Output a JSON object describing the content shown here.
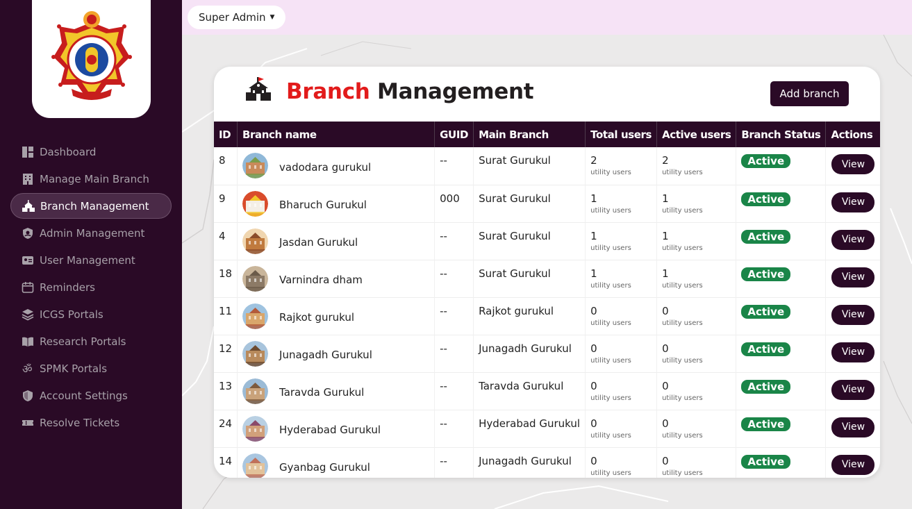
{
  "sidebar": {
    "items": [
      {
        "label": "Dashboard",
        "icon": "dashboard-icon"
      },
      {
        "label": "Manage Main Branch",
        "icon": "building-icon"
      },
      {
        "label": "Branch Management",
        "icon": "school-icon",
        "active": true
      },
      {
        "label": "Admin Management",
        "icon": "admin-shield-icon"
      },
      {
        "label": "User Management",
        "icon": "id-card-icon"
      },
      {
        "label": "Reminders",
        "icon": "calendar-icon"
      },
      {
        "label": "ICGS Portals",
        "icon": "layers-icon"
      },
      {
        "label": "Research Portals",
        "icon": "book-open-icon"
      },
      {
        "label": "SPMK Portals",
        "icon": "om-icon"
      },
      {
        "label": "Account Settings",
        "icon": "shield-icon"
      },
      {
        "label": "Resolve Tickets",
        "icon": "ticket-icon"
      }
    ]
  },
  "topbar": {
    "user_menu": "Super Admin"
  },
  "header": {
    "title_accent": "Branch",
    "title_rest": " Management",
    "add_button": "Add branch"
  },
  "table": {
    "columns": [
      "ID",
      "Branch name",
      "GUID",
      "Main Branch",
      "Total users",
      "Active users",
      "Branch Status",
      "Actions"
    ],
    "users_caption": "utility users",
    "rows": [
      {
        "id": "8",
        "name": "vadodara gurukul",
        "guid": "--",
        "main_branch": "Surat Gurukul",
        "total_users": "2",
        "active_users": "2",
        "status": "Active",
        "action": "View"
      },
      {
        "id": "9",
        "name": "Bharuch Gurukul",
        "guid": "000",
        "main_branch": "Surat Gurukul",
        "total_users": "1",
        "active_users": "1",
        "status": "Active",
        "action": "View"
      },
      {
        "id": "4",
        "name": "Jasdan Gurukul",
        "guid": "--",
        "main_branch": "Surat Gurukul",
        "total_users": "1",
        "active_users": "1",
        "status": "Active",
        "action": "View"
      },
      {
        "id": "18",
        "name": "Varnindra dham",
        "guid": "--",
        "main_branch": "Surat Gurukul",
        "total_users": "1",
        "active_users": "1",
        "status": "Active",
        "action": "View"
      },
      {
        "id": "11",
        "name": "Rajkot gurukul",
        "guid": "--",
        "main_branch": "Rajkot gurukul",
        "total_users": "0",
        "active_users": "0",
        "status": "Active",
        "action": "View"
      },
      {
        "id": "12",
        "name": "Junagadh Gurukul",
        "guid": "--",
        "main_branch": "Junagadh Gurukul",
        "total_users": "0",
        "active_users": "0",
        "status": "Active",
        "action": "View"
      },
      {
        "id": "13",
        "name": "Taravda Gurukul",
        "guid": "--",
        "main_branch": "Taravda Gurukul",
        "total_users": "0",
        "active_users": "0",
        "status": "Active",
        "action": "View"
      },
      {
        "id": "24",
        "name": "Hyderabad Gurukul",
        "guid": "--",
        "main_branch": "Hyderabad Gurukul",
        "total_users": "0",
        "active_users": "0",
        "status": "Active",
        "action": "View"
      },
      {
        "id": "14",
        "name": "Gyanbag Gurukul",
        "guid": "--",
        "main_branch": "Junagadh Gurukul",
        "total_users": "0",
        "active_users": "0",
        "status": "Active",
        "action": "View"
      }
    ]
  },
  "colors": {
    "sidebar_bg": "#2a0a26",
    "accent_red": "#e21b1b",
    "status_green": "#1a8548",
    "topbar_bg": "#f6e3f6"
  }
}
